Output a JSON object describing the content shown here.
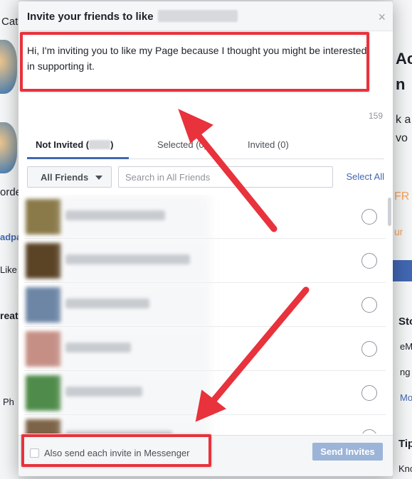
{
  "dialog": {
    "title": "Invite your friends to like",
    "close_label": "×",
    "message": "Hi, I'm inviting you to like my Page because I thought you might be interested in supporting it.",
    "char_count": "159"
  },
  "tabs": [
    {
      "label": "Not Invited (",
      "suffix": ")",
      "active": true
    },
    {
      "label": "Selected (0)",
      "active": false
    },
    {
      "label": "Invited (0)",
      "active": false
    }
  ],
  "filter": {
    "friends_label": "All Friends",
    "search_placeholder": "Search in All Friends",
    "select_all": "Select All"
  },
  "friends_visible": 6,
  "footer": {
    "messenger_label": "Also send each invite in Messenger",
    "send_label": "Send Invites"
  },
  "background": {
    "left_fragments": [
      "Cat",
      "orde",
      "adpa",
      "Like",
      "reat",
      "Ph"
    ],
    "right_fragments": [
      "Ac",
      "n",
      "k a",
      "vo",
      "FR",
      "ur",
      "Sto",
      "eM",
      "ng",
      "Mo",
      "Tip",
      "Kno"
    ]
  },
  "colors": {
    "accent": "#4267b2",
    "annotation": "#e8323c"
  }
}
